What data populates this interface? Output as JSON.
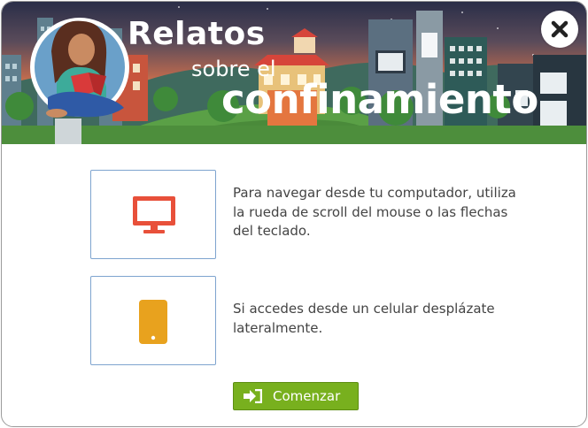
{
  "header": {
    "title_line1": "Relatos",
    "title_line2": "sobre el",
    "title_line3": "confinamiento",
    "close_icon": "close-icon"
  },
  "options": [
    {
      "icon": "monitor-icon",
      "icon_color": "#e8503a",
      "text": "Para navegar desde tu computador, utiliza la rueda de scroll del mouse o las flechas del teclado."
    },
    {
      "icon": "phone-icon",
      "icon_color": "#e8a21e",
      "text": "Si accedes desde un celular desplázate lateralmente."
    }
  ],
  "start_button": {
    "label": "Comenzar",
    "icon": "enter-icon",
    "color": "#78b01e"
  }
}
